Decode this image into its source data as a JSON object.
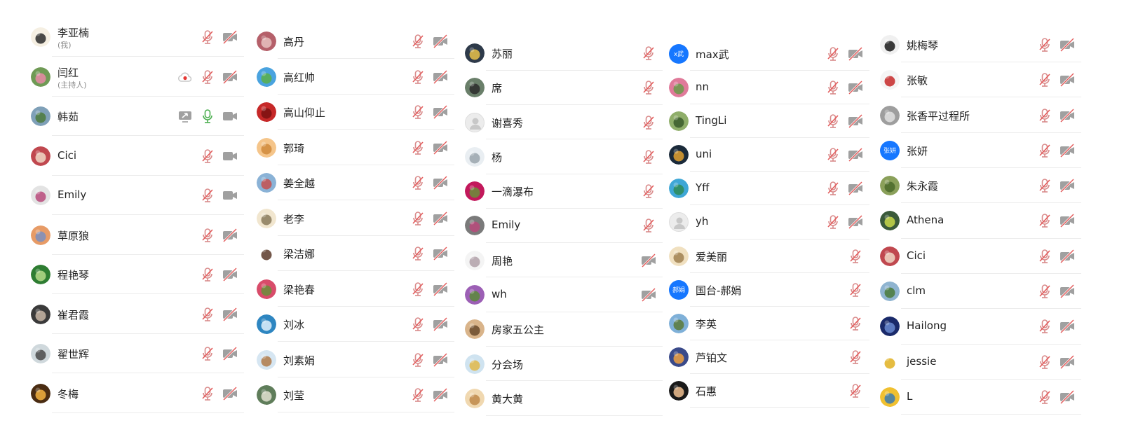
{
  "columns": [
    {
      "members": [
        {
          "name": "李亚楠",
          "sub": "(我)",
          "avatar": {
            "kind": "img",
            "c1": "#f5efe2",
            "c2": "#2b2b2b"
          },
          "icons": [
            "mic-off-icon",
            "camera-off-icon"
          ]
        },
        {
          "name": "闫红",
          "sub": "(主持人)",
          "avatar": {
            "kind": "img",
            "c1": "#6f9a55",
            "c2": "#e98aa7"
          },
          "icons": [
            "cloud-record-icon",
            "mic-off-icon",
            "camera-off-icon"
          ]
        },
        {
          "name": "韩茹",
          "avatar": {
            "kind": "img",
            "c1": "#7fa0b8",
            "c2": "#4c7a3c"
          },
          "icons": [
            "screen-share-icon",
            "mic-on-icon",
            "camera-on-icon"
          ]
        },
        {
          "name": "Cici",
          "avatar": {
            "kind": "img",
            "c1": "#c0484f",
            "c2": "#f0d9c5"
          },
          "icons": [
            "mic-off-icon",
            "camera-on-icon"
          ]
        },
        {
          "name": "Emily",
          "avatar": {
            "kind": "img",
            "c1": "#e3e3e3",
            "c2": "#b94a7b"
          },
          "icons": [
            "mic-off-icon",
            "camera-on-icon"
          ]
        },
        {
          "name": "草原狼",
          "avatar": {
            "kind": "img",
            "c1": "#e79b66",
            "c2": "#7a8fbf"
          },
          "icons": [
            "mic-off-icon",
            "camera-off-icon"
          ]
        },
        {
          "name": "程艳琴",
          "avatar": {
            "kind": "img",
            "c1": "#2e7d32",
            "c2": "#b4d98a"
          },
          "icons": [
            "mic-off-icon",
            "camera-off-icon"
          ]
        },
        {
          "name": "崔君霞",
          "avatar": {
            "kind": "img",
            "c1": "#3a3a3a",
            "c2": "#c8b6a6"
          },
          "icons": [
            "mic-off-icon",
            "camera-off-icon"
          ]
        },
        {
          "name": "翟世辉",
          "avatar": {
            "kind": "img",
            "c1": "#cfd8dc",
            "c2": "#4a4a4a"
          },
          "icons": [
            "mic-off-icon",
            "camera-off-icon"
          ]
        },
        {
          "name": "冬梅",
          "avatar": {
            "kind": "img",
            "c1": "#4a2c12",
            "c2": "#f3b240"
          },
          "icons": [
            "mic-off-icon",
            "camera-off-icon"
          ]
        }
      ]
    },
    {
      "members": [
        {
          "name": "高丹",
          "avatar": {
            "kind": "img",
            "c1": "#b5606a",
            "c2": "#e7c2c0"
          },
          "icons": [
            "mic-off-icon",
            "camera-off-icon"
          ]
        },
        {
          "name": "高红帅",
          "avatar": {
            "kind": "img",
            "c1": "#4aa3df",
            "c2": "#5bb04a"
          },
          "icons": [
            "mic-off-icon",
            "camera-off-icon"
          ]
        },
        {
          "name": "高山仰止",
          "avatar": {
            "kind": "img",
            "c1": "#c62828",
            "c2": "#7a1010"
          },
          "icons": [
            "mic-off-icon",
            "camera-off-icon"
          ]
        },
        {
          "name": "郭琦",
          "avatar": {
            "kind": "img",
            "c1": "#f5c58a",
            "c2": "#d08a3b"
          },
          "icons": [
            "mic-off-icon",
            "camera-off-icon"
          ]
        },
        {
          "name": "姜全越",
          "avatar": {
            "kind": "img",
            "c1": "#8ab2d6",
            "c2": "#c65050"
          },
          "icons": [
            "mic-off-icon",
            "camera-off-icon"
          ]
        },
        {
          "name": "老李",
          "avatar": {
            "kind": "img",
            "c1": "#f1e6cf",
            "c2": "#8a7a5c"
          },
          "icons": [
            "mic-off-icon",
            "camera-off-icon"
          ]
        },
        {
          "name": "梁洁娜",
          "avatar": {
            "kind": "img",
            "c1": "#ffffff",
            "c2": "#5a3a2a"
          },
          "icons": [
            "mic-off-icon",
            "camera-off-icon"
          ]
        },
        {
          "name": "梁艳春",
          "avatar": {
            "kind": "img",
            "c1": "#d84c6a",
            "c2": "#6a8f3a"
          },
          "icons": [
            "mic-off-icon",
            "camera-off-icon"
          ]
        },
        {
          "name": "刘冰",
          "avatar": {
            "kind": "img",
            "c1": "#2e86c1",
            "c2": "#dff0fb"
          },
          "icons": [
            "mic-off-icon",
            "camera-off-icon"
          ]
        },
        {
          "name": "刘素娟",
          "avatar": {
            "kind": "img",
            "c1": "#d6e6f2",
            "c2": "#b07a4a"
          },
          "icons": [
            "mic-off-icon",
            "camera-off-icon"
          ]
        },
        {
          "name": "刘莹",
          "avatar": {
            "kind": "img",
            "c1": "#5f7d5a",
            "c2": "#e0e0d0"
          },
          "icons": [
            "mic-off-icon",
            "camera-off-icon"
          ]
        }
      ]
    },
    {
      "members": [
        {
          "name": "苏丽",
          "avatar": {
            "kind": "img",
            "c1": "#2e3a4a",
            "c2": "#e8c24a"
          },
          "icons": [
            "mic-off-icon"
          ]
        },
        {
          "name": "席",
          "avatar": {
            "kind": "img",
            "c1": "#6a7f6a",
            "c2": "#2b2b2b"
          },
          "icons": [
            "mic-off-icon"
          ]
        },
        {
          "name": "谢喜秀",
          "avatar": {
            "kind": "placeholder",
            "c1": "#ececec",
            "c2": "#c8c8c8"
          },
          "icons": [
            "mic-off-icon"
          ]
        },
        {
          "name": "杨",
          "avatar": {
            "kind": "img",
            "c1": "#e9eef2",
            "c2": "#9aa4ad"
          },
          "icons": [
            "mic-off-icon"
          ]
        },
        {
          "name": "一滴瀑布",
          "avatar": {
            "kind": "img",
            "c1": "#c2185b",
            "c2": "#6a8f3a"
          },
          "icons": [
            "mic-off-icon"
          ]
        },
        {
          "name": "Emily",
          "avatar": {
            "kind": "img",
            "c1": "#7a7a7a",
            "c2": "#b94a7b"
          },
          "icons": [
            "mic-off-icon"
          ]
        },
        {
          "name": "周艳",
          "avatar": {
            "kind": "img",
            "c1": "#f4f4f4",
            "c2": "#b0a0a8"
          },
          "icons": [
            "camera-off-icon"
          ]
        },
        {
          "name": "wh",
          "avatar": {
            "kind": "img",
            "c1": "#9c5fb5",
            "c2": "#5a8a3a"
          },
          "icons": [
            "camera-off-icon"
          ]
        },
        {
          "name": "房家五公主",
          "avatar": {
            "kind": "img",
            "c1": "#d9b48a",
            "c2": "#6a4a2a"
          },
          "icons": []
        },
        {
          "name": "分会场",
          "avatar": {
            "kind": "img",
            "c1": "#cfe3f0",
            "c2": "#e0b94a"
          },
          "icons": []
        },
        {
          "name": "黄大黄",
          "avatar": {
            "kind": "img",
            "c1": "#f0d8b0",
            "c2": "#c08a4a"
          },
          "icons": []
        }
      ]
    },
    {
      "members": [
        {
          "name": "max武",
          "avatar": {
            "kind": "text",
            "text": "x武",
            "bg": "#1677ff"
          },
          "icons": [
            "mic-off-icon",
            "camera-off-icon"
          ]
        },
        {
          "name": "nn",
          "avatar": {
            "kind": "img",
            "c1": "#e07a9a",
            "c2": "#6a9a4a"
          },
          "icons": [
            "mic-off-icon",
            "camera-off-icon"
          ]
        },
        {
          "name": "TingLi",
          "avatar": {
            "kind": "img",
            "c1": "#8fae6a",
            "c2": "#3a5a2a"
          },
          "icons": [
            "mic-off-icon",
            "camera-off-icon"
          ]
        },
        {
          "name": "uni",
          "avatar": {
            "kind": "img",
            "c1": "#1a2a3a",
            "c2": "#e0a030"
          },
          "icons": [
            "mic-off-icon",
            "camera-off-icon"
          ]
        },
        {
          "name": "Yff",
          "avatar": {
            "kind": "img",
            "c1": "#3fa7d6",
            "c2": "#2e8b57"
          },
          "icons": [
            "mic-off-icon",
            "camera-off-icon"
          ]
        },
        {
          "name": "yh",
          "avatar": {
            "kind": "placeholder",
            "c1": "#ececec",
            "c2": "#c8c8c8"
          },
          "icons": [
            "mic-off-icon",
            "camera-off-icon"
          ]
        },
        {
          "name": "爱美丽",
          "avatar": {
            "kind": "img",
            "c1": "#f0e0c0",
            "c2": "#a08050"
          },
          "icons": [
            "mic-off-icon"
          ]
        },
        {
          "name": "国台-郝娟",
          "avatar": {
            "kind": "text",
            "text": "郝娟",
            "bg": "#1677ff"
          },
          "icons": [
            "mic-off-icon"
          ]
        },
        {
          "name": "李英",
          "avatar": {
            "kind": "img",
            "c1": "#7fb0d8",
            "c2": "#5a7a3a"
          },
          "icons": [
            "mic-off-icon"
          ]
        },
        {
          "name": "芦铂文",
          "avatar": {
            "kind": "img",
            "c1": "#3a4a8a",
            "c2": "#f0a040"
          },
          "icons": [
            "mic-off-icon"
          ]
        },
        {
          "name": "石惠",
          "avatar": {
            "kind": "img",
            "c1": "#1a1a1a",
            "c2": "#f0c090"
          },
          "icons": [
            "mic-off-icon"
          ]
        }
      ]
    },
    {
      "members": [
        {
          "name": "姚梅琴",
          "avatar": {
            "kind": "img",
            "c1": "#f0f0f0",
            "c2": "#1a1a1a"
          },
          "icons": [
            "mic-off-icon",
            "camera-off-icon"
          ]
        },
        {
          "name": "张敏",
          "avatar": {
            "kind": "img",
            "c1": "#f5f5f5",
            "c2": "#c62828"
          },
          "icons": [
            "mic-off-icon",
            "camera-off-icon"
          ]
        },
        {
          "name": "张香平过程所",
          "avatar": {
            "kind": "img",
            "c1": "#9e9e9e",
            "c2": "#e0e0e0"
          },
          "icons": [
            "mic-off-icon",
            "camera-off-icon"
          ]
        },
        {
          "name": "张妍",
          "avatar": {
            "kind": "text",
            "text": "张妍",
            "bg": "#1677ff"
          },
          "icons": [
            "mic-off-icon",
            "camera-off-icon"
          ]
        },
        {
          "name": "朱永霞",
          "avatar": {
            "kind": "img",
            "c1": "#8aa05a",
            "c2": "#4a6a2a"
          },
          "icons": [
            "mic-off-icon",
            "camera-off-icon"
          ]
        },
        {
          "name": "Athena",
          "avatar": {
            "kind": "img",
            "c1": "#3a5a3a",
            "c2": "#c8d84a"
          },
          "icons": [
            "mic-off-icon",
            "camera-off-icon"
          ]
        },
        {
          "name": "Cici",
          "avatar": {
            "kind": "img",
            "c1": "#c0484f",
            "c2": "#f0d9c5"
          },
          "icons": [
            "mic-off-icon",
            "camera-off-icon"
          ]
        },
        {
          "name": "clm",
          "avatar": {
            "kind": "img",
            "c1": "#8fb4d0",
            "c2": "#4a7a3a"
          },
          "icons": [
            "mic-off-icon",
            "camera-off-icon"
          ]
        },
        {
          "name": "Hailong",
          "avatar": {
            "kind": "img",
            "c1": "#1a2a6a",
            "c2": "#6a8ad0"
          },
          "icons": [
            "mic-off-icon",
            "camera-off-icon"
          ]
        },
        {
          "name": "jessie",
          "avatar": {
            "kind": "img",
            "c1": "#ffffff",
            "c2": "#e0b020"
          },
          "icons": [
            "mic-off-icon",
            "camera-off-icon"
          ]
        },
        {
          "name": "L",
          "avatar": {
            "kind": "img",
            "c1": "#f0c030",
            "c2": "#3a7ab0"
          },
          "icons": [
            "mic-off-icon",
            "camera-off-icon"
          ]
        }
      ]
    }
  ],
  "colors": {
    "mic_off": "#d98a8a",
    "mic_off_slash": "#e35b5b",
    "icon_gray": "#a0a0a0",
    "mic_on": "#4caf50",
    "record": "#e53935"
  }
}
